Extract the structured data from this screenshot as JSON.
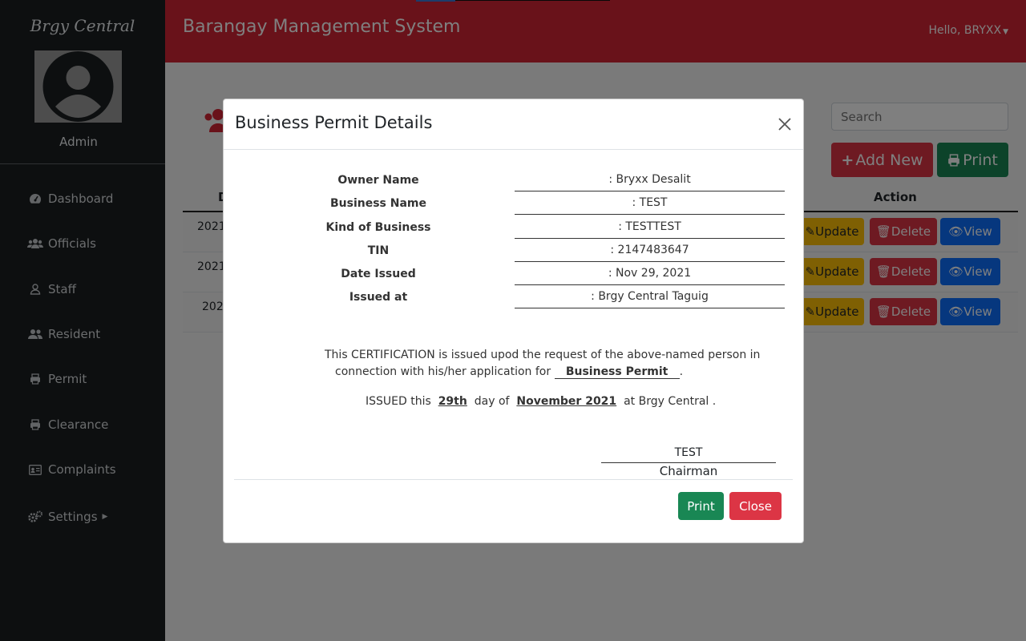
{
  "sidebar": {
    "brand": "Brgy Central",
    "role": "Admin",
    "items": [
      {
        "label": "Dashboard",
        "icon": "gauge-icon"
      },
      {
        "label": "Officials",
        "icon": "users-icon"
      },
      {
        "label": "Staff",
        "icon": "user-icon"
      },
      {
        "label": "Resident",
        "icon": "user-group-icon"
      },
      {
        "label": "Permit",
        "icon": "printer-icon"
      },
      {
        "label": "Clearance",
        "icon": "printer-icon"
      },
      {
        "label": "Complaints",
        "icon": "id-card-icon"
      },
      {
        "label": "Settings",
        "icon": "gears-icon"
      }
    ]
  },
  "topbar": {
    "title": "Barangay Management System",
    "user": "Hello, BRYXX"
  },
  "main": {
    "search_placeholder": "Search",
    "add_new_label": "Add New",
    "print_label": "Print",
    "table": {
      "col_date_partial": "D",
      "col_action": "Action",
      "rows": [
        {
          "date_partial": "2021",
          "update": "Update",
          "delete": "Delete",
          "view": "View"
        },
        {
          "date_partial": "2021",
          "update": "Update",
          "delete": "Delete",
          "view": "View"
        },
        {
          "date_partial": "202",
          "update": "Update",
          "delete": "Delete",
          "view": "View"
        }
      ]
    }
  },
  "modal": {
    "title": "Business Permit Details",
    "fields": [
      {
        "label": "Owner Name",
        "value": ": Bryxx Desalit"
      },
      {
        "label": "Business Name",
        "value": ": TEST"
      },
      {
        "label": "Kind of Business",
        "value": ": TESTTEST"
      },
      {
        "label": "TIN",
        "value": ": 2147483647"
      },
      {
        "label": "Date Issued",
        "value": ": Nov 29, 2021"
      },
      {
        "label": "Issued at",
        "value": ": Brgy Central Taguig"
      }
    ],
    "cert_line1": "This CERTIFICATION is issued upod the request of the above-named person in",
    "cert_line2_prefix": "connection with his/her application for",
    "cert_permit": "Business Permit",
    "cert_line2_suffix": ".",
    "issued_prefix": "ISSUED this",
    "issued_day": "29th",
    "issued_mid": "day of",
    "issued_month": "November 2021",
    "issued_suffix": "at Brgy Central .",
    "signatory": "TEST",
    "signatory_title": "Chairman",
    "print_button": "Print",
    "close_button": "Close"
  },
  "colors": {
    "topbar": "#d22534",
    "sidebar": "#1b1e21",
    "success": "#198754",
    "danger": "#dc3545",
    "warning": "#ffc107",
    "primary": "#0d6efd"
  }
}
